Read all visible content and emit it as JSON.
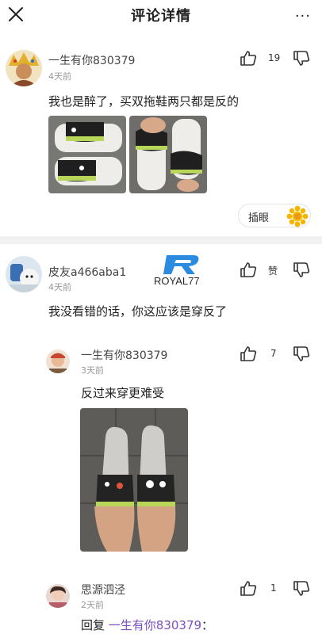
{
  "header": {
    "title": "评论详情",
    "more": "···"
  },
  "comment1": {
    "user": "一生有你830379",
    "time": "4天前",
    "text": "我也是醉了，买双拖鞋两只都是反的",
    "likes": "19",
    "chip_label": "插眼"
  },
  "comment2": {
    "user": "皮友a466aba1",
    "time": "4天前",
    "text": "我没看错的话，你这应该是穿反了",
    "likes": "赞",
    "watermark": "ROYAL77"
  },
  "reply1": {
    "user": "一生有你830379",
    "time": "3天前",
    "text": "反过来穿更难受",
    "likes": "7"
  },
  "reply2": {
    "user": "思源泗泾",
    "time": "2天前",
    "likes": "1",
    "reply_prefix": "回复 ",
    "mention": "一生有你830379",
    "reply_suffix": "："
  },
  "colors": {
    "mention": "#7a4fc0",
    "divider": "#f1f1f1",
    "slipper_green": "#b7d65a"
  }
}
